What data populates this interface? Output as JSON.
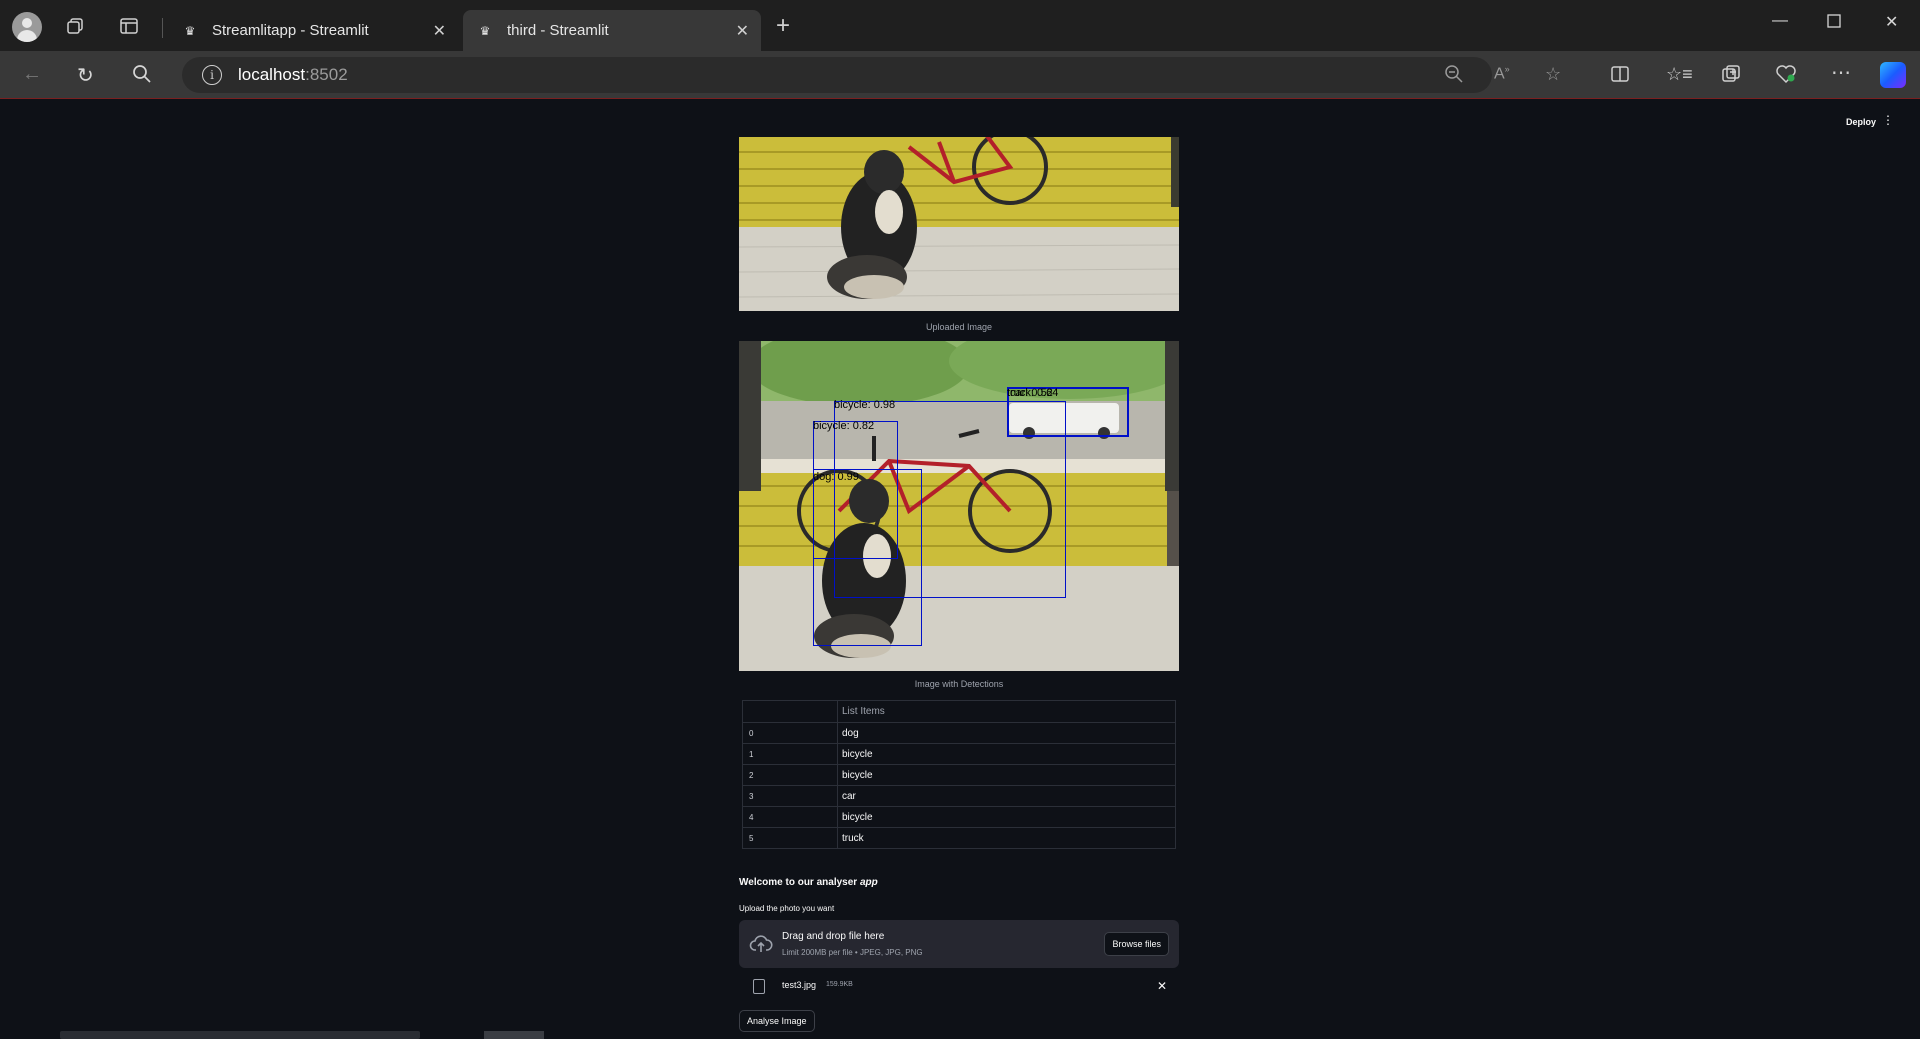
{
  "browser": {
    "tabs": [
      {
        "title": "Streamlitapp - Streamlit",
        "active": false
      },
      {
        "title": "third - Streamlit",
        "active": true
      }
    ],
    "url_host": "localhost",
    "url_port": ":8502"
  },
  "app": {
    "deploy_label": "Deploy",
    "uploaded_caption": "Uploaded Image",
    "detections_caption": "Image with Detections",
    "detections": [
      {
        "label": "bicycle: 0.98"
      },
      {
        "label": "bicycle: 0.82"
      },
      {
        "label": "dog: 0.99"
      },
      {
        "label": "truck: 0.64"
      },
      {
        "label": "car: 0.52"
      }
    ],
    "table": {
      "column": "List Items",
      "rows": [
        {
          "index": "0",
          "value": "dog"
        },
        {
          "index": "1",
          "value": "bicycle"
        },
        {
          "index": "2",
          "value": "bicycle"
        },
        {
          "index": "3",
          "value": "car"
        },
        {
          "index": "4",
          "value": "bicycle"
        },
        {
          "index": "5",
          "value": "truck"
        }
      ]
    },
    "welcome_prefix": "Welcome to our analyser ",
    "welcome_em": "app",
    "upload_label": "Upload the photo you want",
    "dropzone_title": "Drag and drop file here",
    "dropzone_limit": "Limit 200MB per file • JPEG, JPG, PNG",
    "browse_label": "Browse files",
    "file_name": "test3.jpg",
    "file_size": "159.9KB",
    "analyse_label": "Analyse Image"
  }
}
